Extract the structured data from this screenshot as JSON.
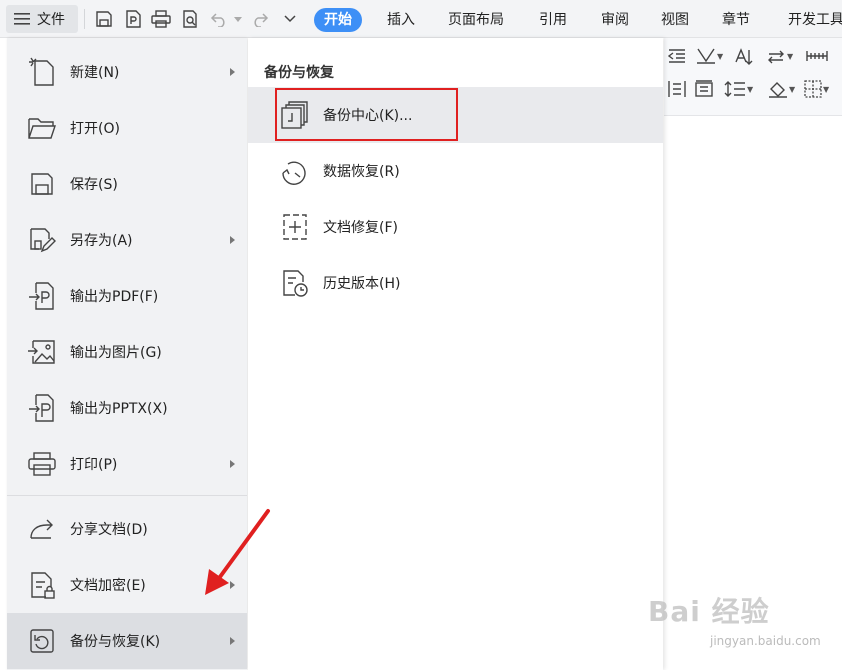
{
  "topbar": {
    "file_menu_label": "文件",
    "tabs": [
      {
        "label": "开始",
        "active": true
      },
      {
        "label": "插入",
        "active": false
      },
      {
        "label": "页面布局",
        "active": false
      },
      {
        "label": "引用",
        "active": false
      },
      {
        "label": "审阅",
        "active": false
      },
      {
        "label": "视图",
        "active": false
      },
      {
        "label": "章节",
        "active": false
      },
      {
        "label": "开发工具",
        "active": false
      }
    ]
  },
  "file_menu": {
    "items": [
      {
        "label": "新建(N)",
        "icon": "new-document-icon",
        "has_submenu": true
      },
      {
        "label": "打开(O)",
        "icon": "folder-open-icon",
        "has_submenu": false
      },
      {
        "label": "保存(S)",
        "icon": "save-icon",
        "has_submenu": false
      },
      {
        "label": "另存为(A)",
        "icon": "save-as-icon",
        "has_submenu": true
      },
      {
        "label": "输出为PDF(F)",
        "icon": "export-pdf-icon",
        "has_submenu": false
      },
      {
        "label": "输出为图片(G)",
        "icon": "export-image-icon",
        "has_submenu": false
      },
      {
        "label": "输出为PPTX(X)",
        "icon": "export-pptx-icon",
        "has_submenu": false
      },
      {
        "label": "打印(P)",
        "icon": "print-icon",
        "has_submenu": true
      },
      {
        "label": "分享文档(D)",
        "icon": "share-icon",
        "has_submenu": false
      },
      {
        "label": "文档加密(E)",
        "icon": "encrypt-document-icon",
        "has_submenu": true
      },
      {
        "label": "备份与恢复(K)",
        "icon": "backup-restore-icon",
        "has_submenu": true,
        "selected": true
      }
    ]
  },
  "submenu": {
    "title": "备份与恢复",
    "items": [
      {
        "label": "备份中心(K)...",
        "icon": "backup-center-icon",
        "highlighted": true
      },
      {
        "label": "数据恢复(R)",
        "icon": "data-recovery-icon"
      },
      {
        "label": "文档修复(F)",
        "icon": "document-repair-icon"
      },
      {
        "label": "历史版本(H)",
        "icon": "history-version-icon"
      }
    ]
  },
  "watermark": {
    "main": "Bai 经验",
    "sub": "jingyan.baidu.com"
  },
  "colors": {
    "accent": "#3d8ff6",
    "annotation_red": "#e02020",
    "menu_bg": "#f1f2f4",
    "selected_bg": "#dcdee2"
  }
}
